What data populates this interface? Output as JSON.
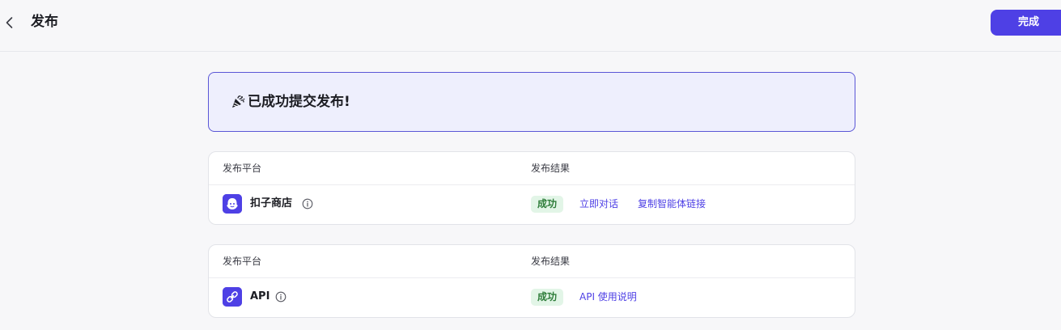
{
  "header": {
    "title": "发布",
    "done_label": "完成",
    "back_icon": "chevron-left-icon"
  },
  "banner": {
    "icon": "party-popper-icon",
    "text": "已成功提交发布!"
  },
  "cards": [
    {
      "col_platform": "发布平台",
      "col_result": "发布结果",
      "platform_icon": "coze-store-icon",
      "platform_name": "扣子商店",
      "status": "成功",
      "links": [
        "立即对话",
        "复制智能体链接"
      ]
    },
    {
      "col_platform": "发布平台",
      "col_result": "发布结果",
      "platform_icon": "api-link-icon",
      "platform_name": "API",
      "status": "成功",
      "links": [
        "API 使用说明"
      ]
    }
  ],
  "colors": {
    "accent": "#4e40e5",
    "success_bg": "#e2f5e7",
    "success_text": "#2e7d3a",
    "banner_bg": "#eeeffd"
  }
}
